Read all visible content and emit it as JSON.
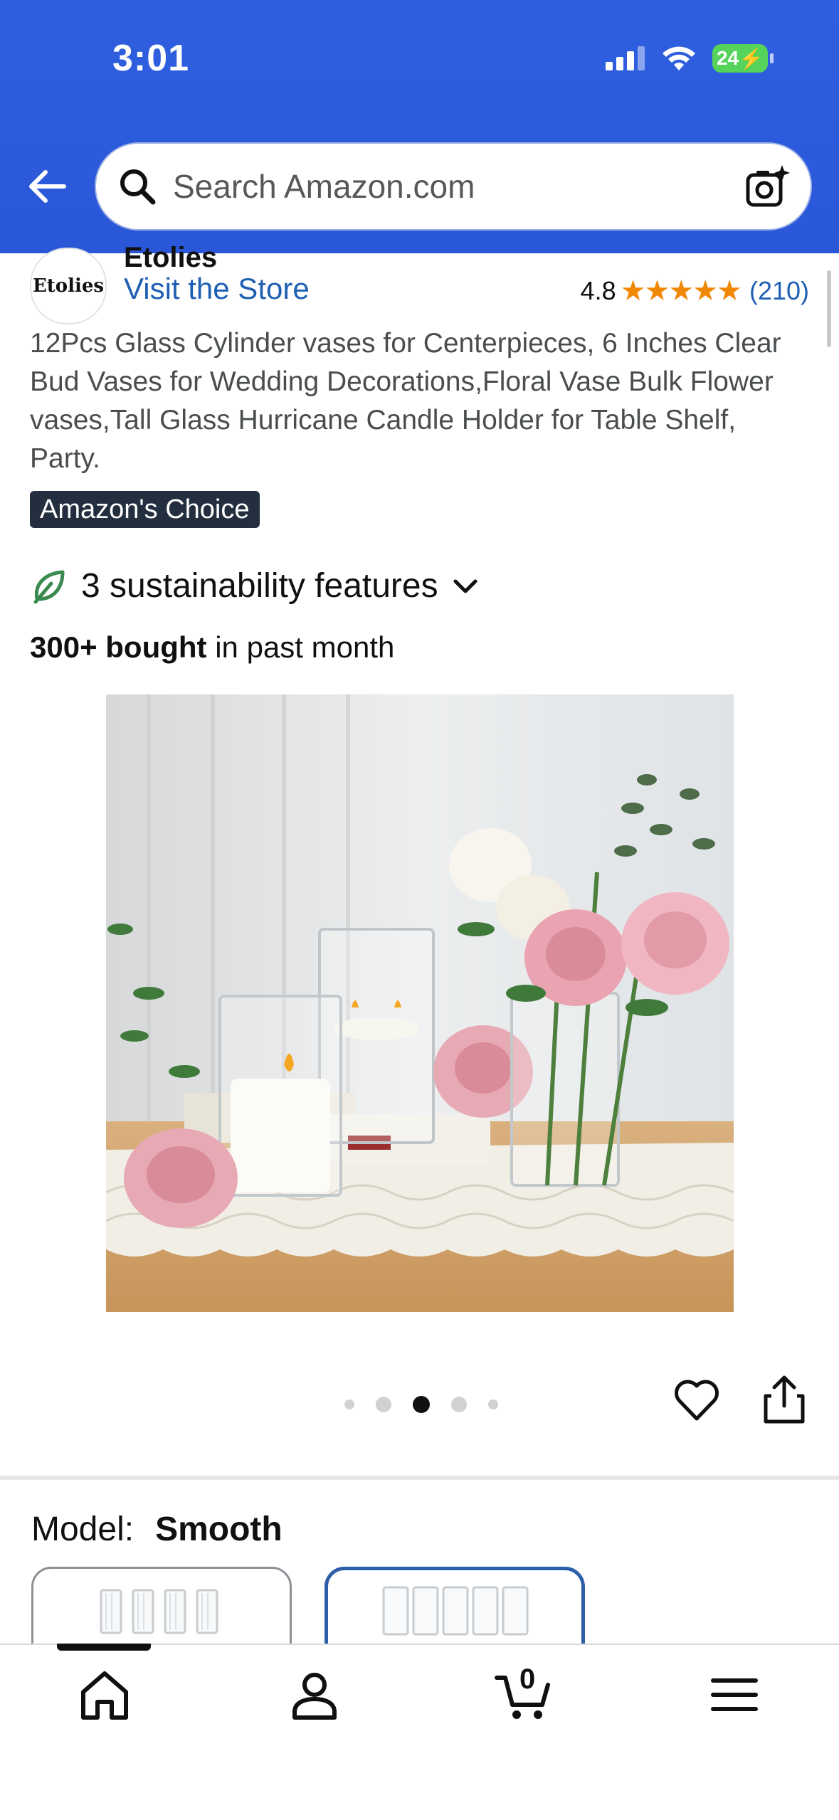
{
  "status_bar": {
    "time": "3:01",
    "battery": "24"
  },
  "search": {
    "placeholder": "Search Amazon.com"
  },
  "store": {
    "logo_text": "Etolies",
    "brand": "Etolies",
    "visit_label": "Visit the Store",
    "rating": "4.8",
    "stars_filled": 4.8,
    "review_count": "(210)"
  },
  "product": {
    "title": "12Pcs Glass Cylinder vases for Centerpieces, 6 Inches Clear Bud Vases for Wedding Decorations,Floral Vase Bulk Flower vases,Tall Glass Hurricane Candle Holder for Table Shelf, Party.",
    "badge": "Amazon's Choice",
    "sustainability": "3 sustainability features",
    "bought_bold": "300+ bought",
    "bought_rest": " in past month"
  },
  "carousel": {
    "total": 5,
    "active_index": 2
  },
  "model": {
    "label": "Model:",
    "value": "Smooth"
  },
  "nav": {
    "cart_count": "0",
    "items": [
      "home-icon",
      "account-icon",
      "cart-icon",
      "menu-icon"
    ]
  },
  "colors": {
    "header": "#2f5fe0",
    "link": "#1f5fb3",
    "star": "#f08804",
    "badge_bg": "#232f3e",
    "selected_border": "#2d5fa8"
  }
}
